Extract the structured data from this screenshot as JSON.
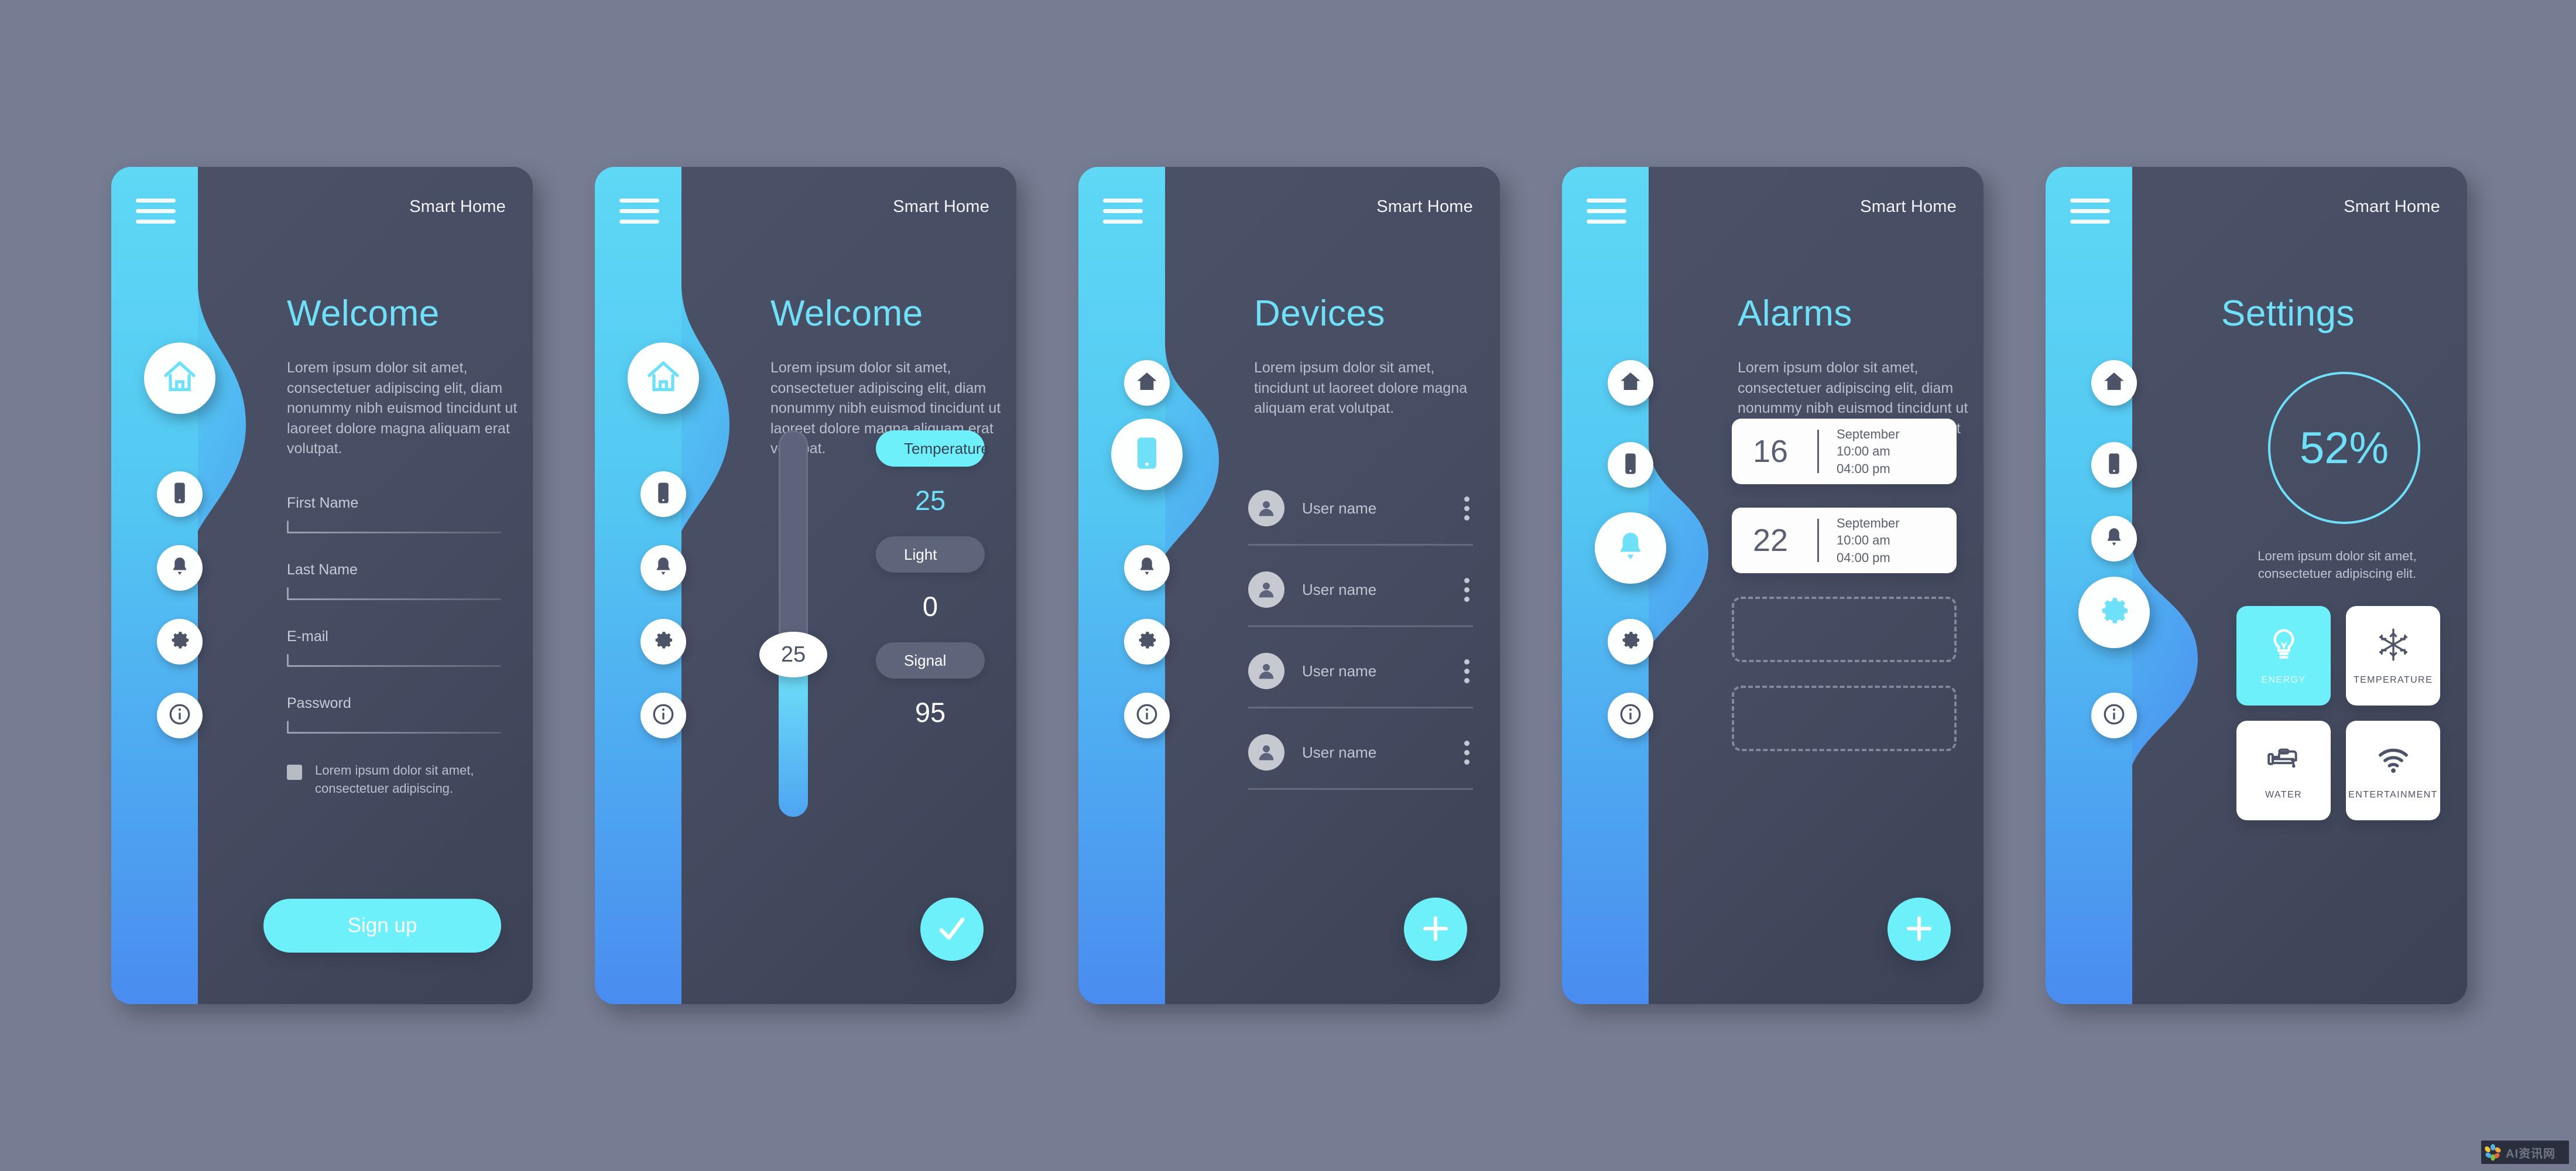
{
  "app": {
    "header_title": "Smart Home",
    "accent": "#6ee0f7",
    "accent_solid": "#6ef0fa",
    "panel_bg": "#474d63",
    "page_bg": "#767c92",
    "rail_top": "#5ed8f5",
    "rail_bottom": "#4a8cf0"
  },
  "nav": {
    "items": [
      {
        "name": "home",
        "icon": "home-icon"
      },
      {
        "name": "devices",
        "icon": "phone-icon"
      },
      {
        "name": "alarms",
        "icon": "bell-icon"
      },
      {
        "name": "settings",
        "icon": "gear-icon"
      },
      {
        "name": "info",
        "icon": "info-icon"
      }
    ]
  },
  "screens": [
    {
      "id": "signup",
      "title": "Welcome",
      "body": "Lorem ipsum dolor sit amet, consectetuer adipiscing elit, diam nonummy nibh euismod tincidunt ut laoreet dolore magna aliquam erat volutpat.",
      "active_nav": "home",
      "fields": [
        {
          "label": "First Name",
          "value": "",
          "placeholder": ""
        },
        {
          "label": "Last Name",
          "value": "",
          "placeholder": ""
        },
        {
          "label": "E-mail",
          "value": "",
          "placeholder": ""
        },
        {
          "label": "Password",
          "value": "",
          "placeholder": ""
        }
      ],
      "consent_text": "Lorem ipsum dolor sit amet, consectetuer adipiscing.",
      "consent_checked": false,
      "submit_label": "Sign up"
    },
    {
      "id": "controls",
      "title": "Welcome",
      "body": "Lorem ipsum dolor sit amet, consectetuer adipiscing elit, diam nonummy nibh euismod tincidunt ut laoreet dolore magna aliquam erat volutpat.",
      "active_nav": "home",
      "slider": {
        "value": "25",
        "percent": 40,
        "min": 0,
        "max": 100
      },
      "controls": [
        {
          "label": "Temperature",
          "value": "25",
          "selected": true
        },
        {
          "label": "Light",
          "value": "0",
          "selected": false
        },
        {
          "label": "Signal",
          "value": "95",
          "selected": false
        }
      ],
      "fab_icon": "check-icon"
    },
    {
      "id": "devices",
      "title": "Devices",
      "body": "Lorem ipsum dolor sit amet, tincidunt ut laoreet dolore magna aliquam erat volutpat.",
      "active_nav": "devices",
      "users": [
        {
          "name": "User name"
        },
        {
          "name": "User name"
        },
        {
          "name": "User name"
        },
        {
          "name": "User name"
        }
      ],
      "fab_icon": "plus-icon"
    },
    {
      "id": "alarms",
      "title": "Alarms",
      "body": "Lorem ipsum dolor sit amet, consectetuer adipiscing elit, diam nonummy nibh euismod tincidunt ut laoreet dolore magna aliquam erat volutpat.",
      "active_nav": "alarms",
      "entries": [
        {
          "day": "16",
          "month": "September",
          "start": "10:00 am",
          "end": "04:00 pm"
        },
        {
          "day": "22",
          "month": "September",
          "start": "10:00 am",
          "end": "04:00 pm"
        }
      ],
      "empty_slots": 2,
      "fab_icon": "plus-icon"
    },
    {
      "id": "settings",
      "title": "Settings",
      "body": "",
      "active_nav": "settings",
      "gauge": {
        "value": "52%",
        "percent": 52
      },
      "note": "Lorem ipsum dolor sit amet, consectetuer adipiscing elit.",
      "tiles": [
        {
          "label": "ENERGY",
          "icon": "bulb-icon",
          "selected": true
        },
        {
          "label": "TEMPERATURE",
          "icon": "snowflake-icon",
          "selected": false
        },
        {
          "label": "WATER",
          "icon": "faucet-icon",
          "selected": false
        },
        {
          "label": "ENTERTAINMENT",
          "icon": "wifi-icon",
          "selected": false
        }
      ]
    }
  ],
  "watermark": {
    "text": "AI资讯网"
  }
}
